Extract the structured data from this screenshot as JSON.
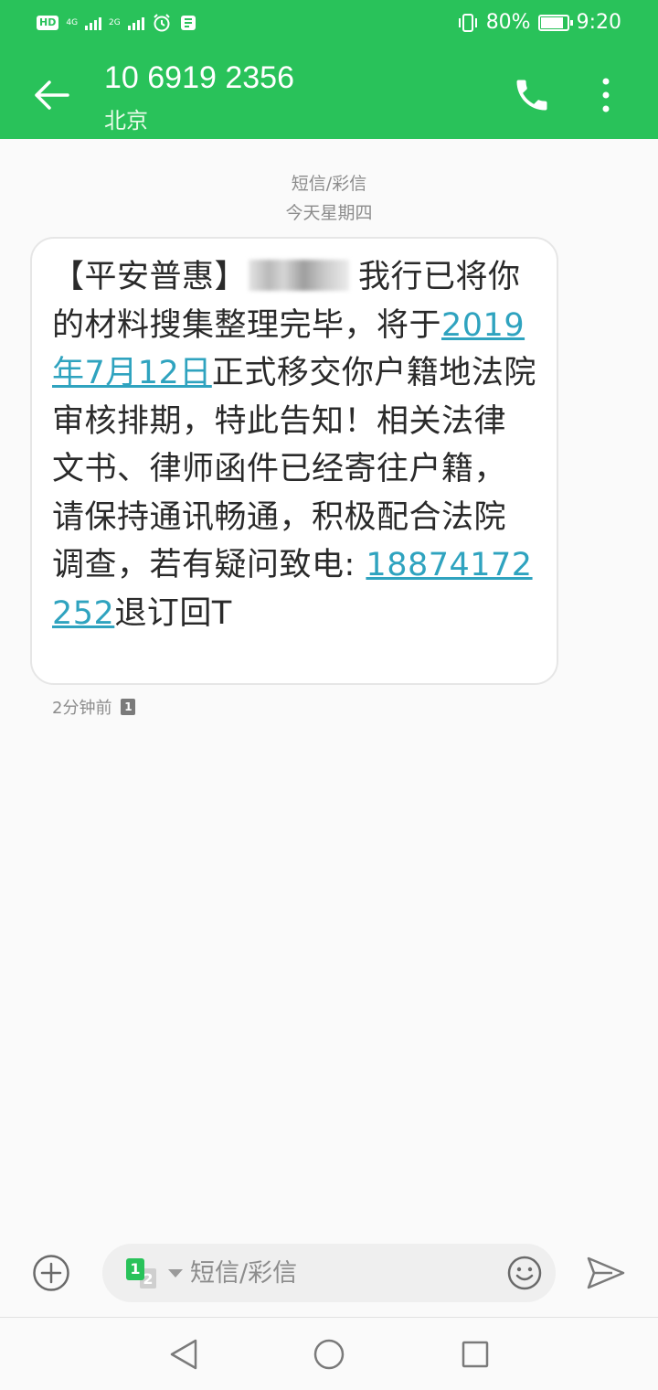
{
  "status_bar": {
    "hd_label": "HD",
    "net1": "4G",
    "net2": "2G",
    "battery": "80%",
    "time": "9:20"
  },
  "header": {
    "number": "10 6919 2356",
    "location": "北京"
  },
  "conversation": {
    "message_type": "短信/彩信",
    "date_label": "今天星期四"
  },
  "message": {
    "prefix": "【平安普惠】",
    "part1": "我行已将你的材料搜集整理完毕，将于",
    "date_link": "2019年7月12日",
    "part2": "正式移交你户籍地法院审核排期，特此告知！相关法律文书、律师函件已经寄往户籍，请保持通讯畅通，积极配合法院调查，若有疑问致电: ",
    "phone_link": "18874172252",
    "part3": "退订回T",
    "time": "2分钟前",
    "sim": "1"
  },
  "composer": {
    "sim1": "1",
    "sim2": "2",
    "placeholder": "短信/彩信"
  },
  "colors": {
    "accent": "#29c25a",
    "link": "#2fa3bf"
  },
  "icons": [
    "back-arrow",
    "phone",
    "more-vertical",
    "add-circle",
    "emoji-smile",
    "send",
    "nav-back",
    "nav-home",
    "nav-recent"
  ]
}
